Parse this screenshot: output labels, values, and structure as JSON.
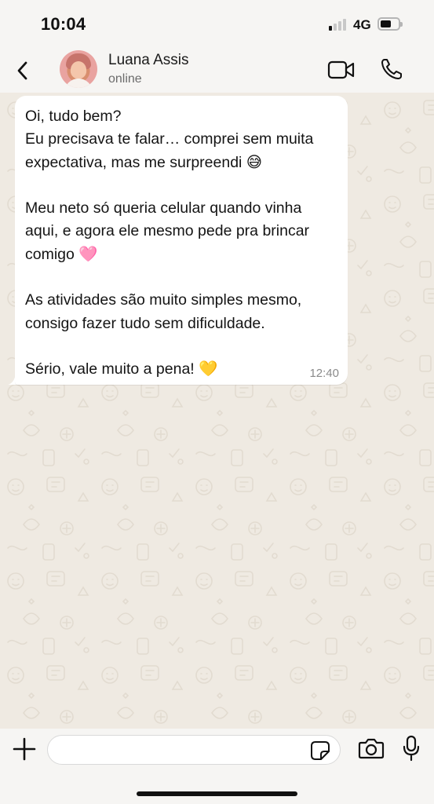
{
  "status_bar": {
    "time": "10:04",
    "network": "4G",
    "signal_bars_on": 1,
    "signal_bars_total": 4,
    "battery_level": 0.5
  },
  "header": {
    "back_icon": "chevron-left-icon",
    "contact_name": "Luana Assis",
    "contact_status": "online",
    "video_icon": "video-camera-icon",
    "call_icon": "phone-icon"
  },
  "chat": {
    "messages": [
      {
        "direction": "incoming",
        "text": "Oi, tudo bem?\nEu precisava te falar… comprei sem muita expectativa, mas me surpreendi 😅\n\nMeu neto só queria celular quando vinha aqui, e agora ele mesmo pede pra brincar comigo 🩷\n\nAs atividades são muito simples mesmo, consigo fazer tudo sem dificuldade.\n\nSério, vale muito a pena! 💛",
        "time": "12:40"
      }
    ]
  },
  "input_bar": {
    "plus_icon": "plus-icon",
    "message_value": "",
    "sticker_icon": "sticker-icon",
    "camera_icon": "camera-icon",
    "mic_icon": "microphone-icon"
  },
  "colors": {
    "chat_background": "#efeae2",
    "bar_background": "#f6f5f3",
    "bubble_incoming": "#ffffff",
    "icon_color": "#111111"
  }
}
